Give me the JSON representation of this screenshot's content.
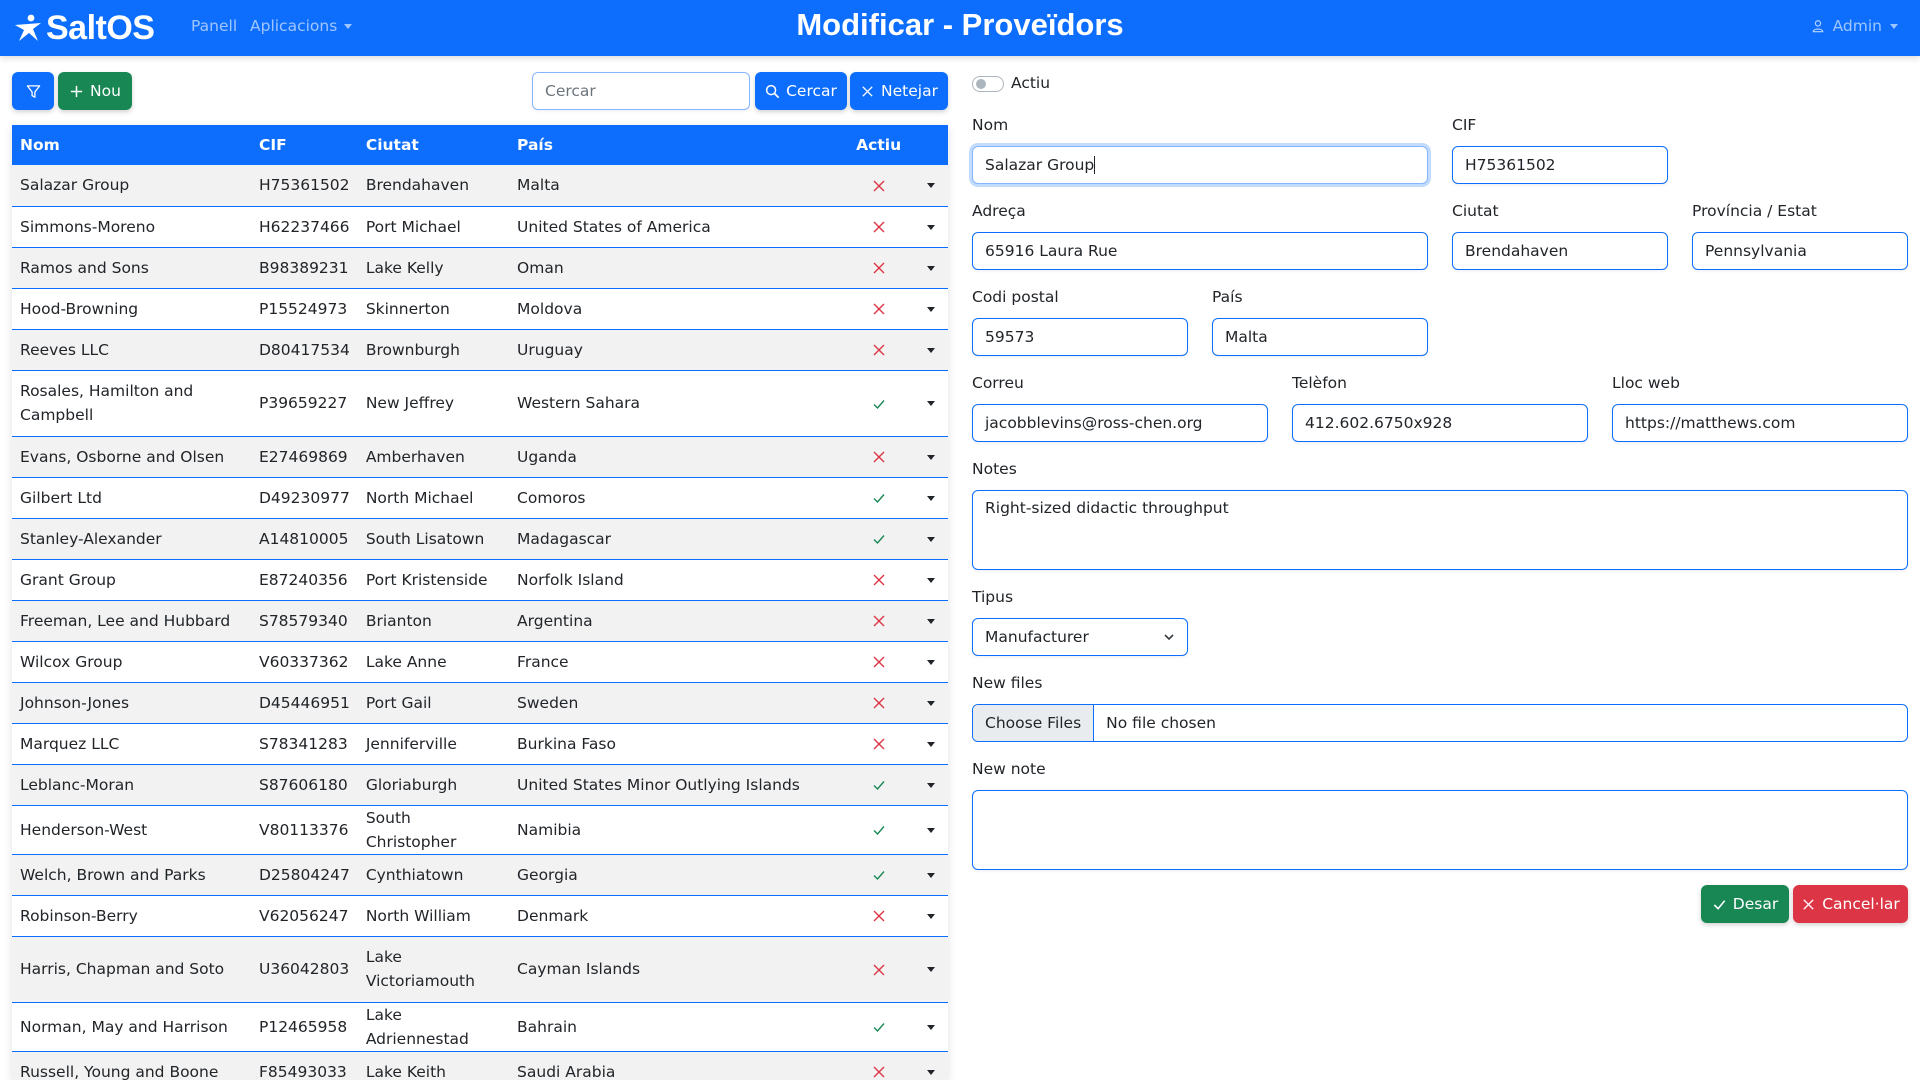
{
  "navbar": {
    "brand": "SaltOS",
    "panell": "Panell",
    "aplicacions": "Aplicacions",
    "title": "Modificar - Proveïdors",
    "user": "Admin"
  },
  "toolbar": {
    "nou_label": "Nou",
    "search_placeholder": "Cercar",
    "search_label": "Cercar",
    "clear_label": "Netejar"
  },
  "table": {
    "headers": [
      "Nom",
      "CIF",
      "Ciutat",
      "País",
      "Actiu"
    ],
    "rows": [
      {
        "nom": "Salazar Group",
        "cif": "H75361502",
        "ciutat": "Brendahaven",
        "pais": "Malta",
        "actiu": false
      },
      {
        "nom": "Simmons-Moreno",
        "cif": "H62237466",
        "ciutat": "Port Michael",
        "pais": "United States of America",
        "actiu": false
      },
      {
        "nom": "Ramos and Sons",
        "cif": "B98389231",
        "ciutat": "Lake Kelly",
        "pais": "Oman",
        "actiu": false
      },
      {
        "nom": "Hood-Browning",
        "cif": "P15524973",
        "ciutat": "Skinnerton",
        "pais": "Moldova",
        "actiu": false
      },
      {
        "nom": "Reeves LLC",
        "cif": "D80417534",
        "ciutat": "Brownburgh",
        "pais": "Uruguay",
        "actiu": false
      },
      {
        "nom": "Rosales, Hamilton and Campbell",
        "cif": "P39659227",
        "ciutat": "New Jeffrey",
        "pais": "Western Sahara",
        "actiu": true
      },
      {
        "nom": "Evans, Osborne and Olsen",
        "cif": "E27469869",
        "ciutat": "Amberhaven",
        "pais": "Uganda",
        "actiu": false
      },
      {
        "nom": "Gilbert Ltd",
        "cif": "D49230977",
        "ciutat": "North Michael",
        "pais": "Comoros",
        "actiu": true
      },
      {
        "nom": "Stanley-Alexander",
        "cif": "A14810005",
        "ciutat": "South Lisatown",
        "pais": "Madagascar",
        "actiu": true
      },
      {
        "nom": "Grant Group",
        "cif": "E87240356",
        "ciutat": "Port Kristenside",
        "pais": "Norfolk Island",
        "actiu": false
      },
      {
        "nom": "Freeman, Lee and Hubbard",
        "cif": "S78579340",
        "ciutat": "Brianton",
        "pais": "Argentina",
        "actiu": false
      },
      {
        "nom": "Wilcox Group",
        "cif": "V60337362",
        "ciutat": "Lake Anne",
        "pais": "France",
        "actiu": false
      },
      {
        "nom": "Johnson-Jones",
        "cif": "D45446951",
        "ciutat": "Port Gail",
        "pais": "Sweden",
        "actiu": false
      },
      {
        "nom": "Marquez LLC",
        "cif": "S78341283",
        "ciutat": "Jenniferville",
        "pais": "Burkina Faso",
        "actiu": false
      },
      {
        "nom": "Leblanc-Moran",
        "cif": "S87606180",
        "ciutat": "Gloriaburgh",
        "pais": "United States Minor Outlying Islands",
        "actiu": true
      },
      {
        "nom": "Henderson-West",
        "cif": "V80113376",
        "ciutat": "South Christopher",
        "pais": "Namibia",
        "actiu": true
      },
      {
        "nom": "Welch, Brown and Parks",
        "cif": "D25804247",
        "ciutat": "Cynthiatown",
        "pais": "Georgia",
        "actiu": true
      },
      {
        "nom": "Robinson-Berry",
        "cif": "V62056247",
        "ciutat": "North William",
        "pais": "Denmark",
        "actiu": false
      },
      {
        "nom": "Harris, Chapman and Soto",
        "cif": "U36042803",
        "ciutat": "Lake Victoriamouth",
        "pais": "Cayman Islands",
        "actiu": false
      },
      {
        "nom": "Norman, May and Harrison",
        "cif": "P12465958",
        "ciutat": "Lake Adriennestad",
        "pais": "Bahrain",
        "actiu": true
      },
      {
        "nom": "Russell, Young and Boone",
        "cif": "F85493033",
        "ciutat": "Lake Keith",
        "pais": "Saudi Arabia",
        "actiu": false
      }
    ]
  },
  "form": {
    "actiu_label": "Actiu",
    "actiu": false,
    "nom_label": "Nom",
    "nom": "Salazar Group",
    "cif_label": "CIF",
    "cif": "H75361502",
    "adreca_label": "Adreça",
    "adreca": "65916 Laura Rue",
    "ciutat_label": "Ciutat",
    "ciutat": "Brendahaven",
    "provincia_label": "Província / Estat",
    "provincia": "Pennsylvania",
    "codi_postal_label": "Codi postal",
    "codi_postal": "59573",
    "pais_label": "País",
    "pais": "Malta",
    "correu_label": "Correu",
    "correu": "jacobblevins@ross-chen.org",
    "telefon_label": "Telèfon",
    "telefon": "412.602.6750x928",
    "lloc_web_label": "Lloc web",
    "lloc_web": "https://matthews.com",
    "notes_label": "Notes",
    "notes": "Right-sized didactic throughput",
    "tipus_label": "Tipus",
    "tipus": "Manufacturer",
    "new_files_label": "New files",
    "choose_files": "Choose Files",
    "no_file": "No file chosen",
    "new_note_label": "New note",
    "new_note": "",
    "save_label": "Desar",
    "cancel_label": "Cancel·lar"
  },
  "colors": {
    "primary": "#0d6efd",
    "success": "#198754",
    "danger": "#dc3545"
  }
}
